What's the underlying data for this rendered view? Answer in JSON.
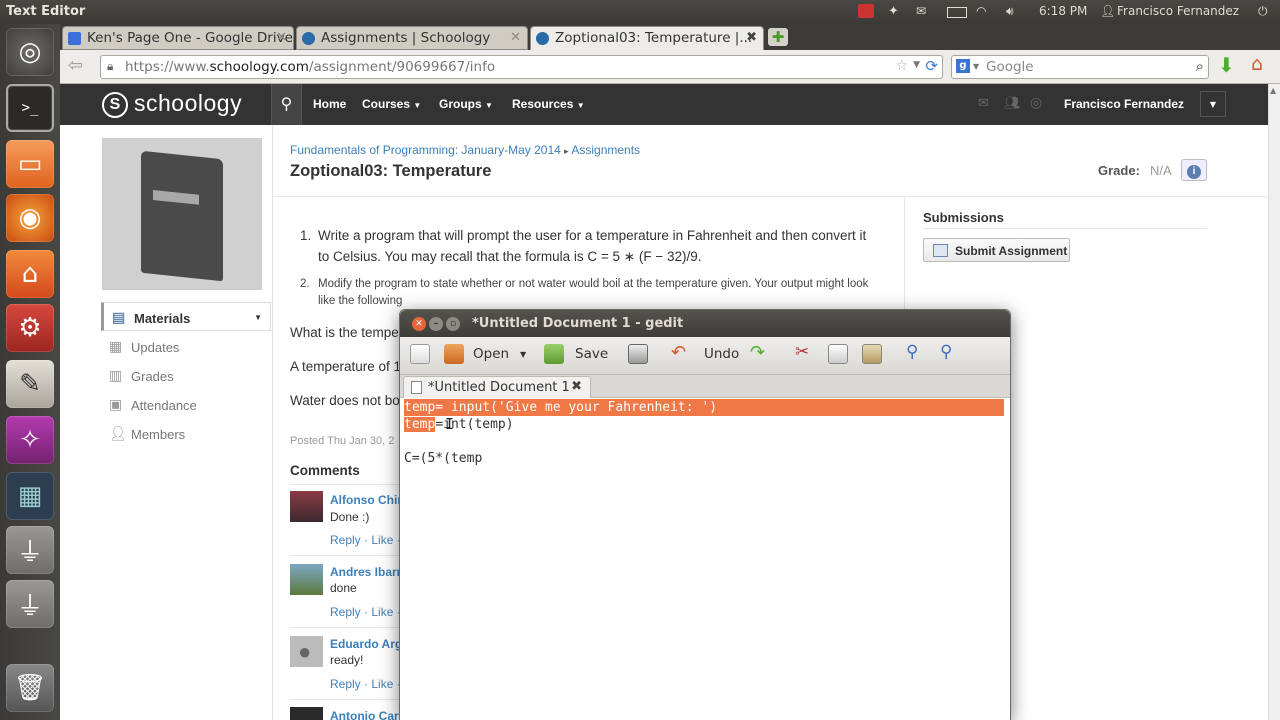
{
  "top_panel": {
    "app_title": "Text Editor",
    "time": "6:18 PM",
    "user": "Francisco Fernandez"
  },
  "browser": {
    "tabs": [
      {
        "label": "Ken's Page One - Google Drive"
      },
      {
        "label": "Assignments | Schoology"
      },
      {
        "label": "Zoptional03: Temperature |..."
      }
    ],
    "url_prefix": "https://www.",
    "url_domain": "schoology.com",
    "url_path": "/assignment/90699667/info",
    "search_placeholder": "Google"
  },
  "schoology": {
    "logo": "schoology",
    "nav": {
      "home": "Home",
      "courses": "Courses",
      "groups": "Groups",
      "resources": "Resources"
    },
    "user": "Francisco Fernandez"
  },
  "sidebar": {
    "items": [
      {
        "label": "Materials"
      },
      {
        "label": "Updates"
      },
      {
        "label": "Grades"
      },
      {
        "label": "Attendance"
      },
      {
        "label": "Members"
      }
    ]
  },
  "assignment": {
    "breadcrumb_course": "Fundamentals of Programming: January-May 2014",
    "breadcrumb_sep": "▸",
    "breadcrumb_section": "Assignments",
    "title": "Zoptional03: Temperature",
    "grade_label": "Grade:",
    "grade_value": "N/A",
    "item1": "Write a program that will prompt the user for a temperature in Fahrenheit and then convert it to Celsius. You may recall that the formula is C = 5 ∗ (F − 32)/9.",
    "item2": "Modify the program to state whether or not water would boil at the temperature given. Your output might look like the following",
    "p1": "What is the tempe",
    "p2": "A temperature of 1",
    "p3": "Water does not bo",
    "posted": "Posted Thu Jan 30, 2",
    "submissions_title": "Submissions",
    "submit_button": "Submit Assignment"
  },
  "comments": {
    "title": "Comments",
    "items": [
      {
        "author": "Alfonso Chin",
        "text": "Done :)",
        "reply": "Reply",
        "like": "Like"
      },
      {
        "author": "Andres Ibarra",
        "text": "done",
        "reply": "Reply",
        "like": "Like"
      },
      {
        "author": "Eduardo Arg",
        "text": "ready!",
        "reply": "Reply",
        "like": "Like"
      },
      {
        "author": "Antonio Carr",
        "text": "",
        "reply": "",
        "like": ""
      }
    ]
  },
  "gedit": {
    "window_title": "*Untitled Document 1 - gedit",
    "toolbar": {
      "open": "Open",
      "save": "Save",
      "undo": "Undo"
    },
    "doc_tab": "*Untitled Document 1",
    "lines": [
      {
        "selected": "temp= input('Give me your Fahrenheit: ')",
        "rest": ""
      },
      {
        "selected": "temp",
        "rest": "=int(temp)"
      },
      {
        "selected": "",
        "rest": ""
      },
      {
        "selected": "",
        "rest": "C=(5*(temp"
      }
    ]
  },
  "colors": {
    "selection": "#f07746",
    "schoology_link": "#3c7fba",
    "header": "#333333"
  }
}
